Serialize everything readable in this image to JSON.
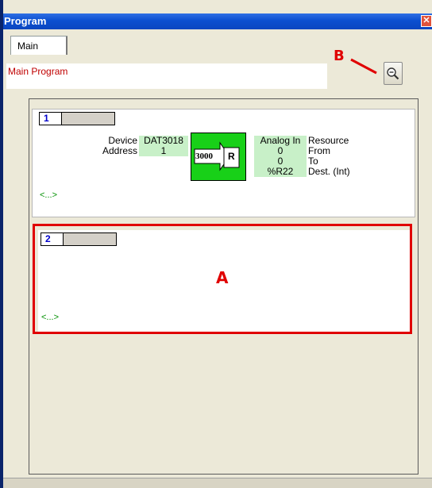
{
  "window": {
    "title": "Program",
    "close_symbol": "✕"
  },
  "tabs": [
    {
      "label": "Main"
    }
  ],
  "program_name": "Main Program",
  "annotations": {
    "a": "A",
    "b": "B"
  },
  "rungs": [
    {
      "number": "1",
      "device_label": "Device",
      "device_value": "DAT3018",
      "address_label": "Address",
      "address_value": "1",
      "block_code": "3000",
      "block_letter": "R",
      "params": [
        {
          "value": "Analog In",
          "label": "Resource"
        },
        {
          "value": "0",
          "label": "From"
        },
        {
          "value": "0",
          "label": "To"
        },
        {
          "value": "%R22",
          "label": "Dest. (Int)"
        }
      ],
      "ellipsis": "<...>"
    },
    {
      "number": "2",
      "ellipsis": "<...>"
    }
  ],
  "colors": {
    "accent_red": "#e00000",
    "block_green": "#18d018",
    "cell_green": "#c8f0c8",
    "title_blue": "#0b4fd0"
  },
  "icons": {
    "zoom": "zoom-out-icon",
    "close": "close-icon"
  }
}
